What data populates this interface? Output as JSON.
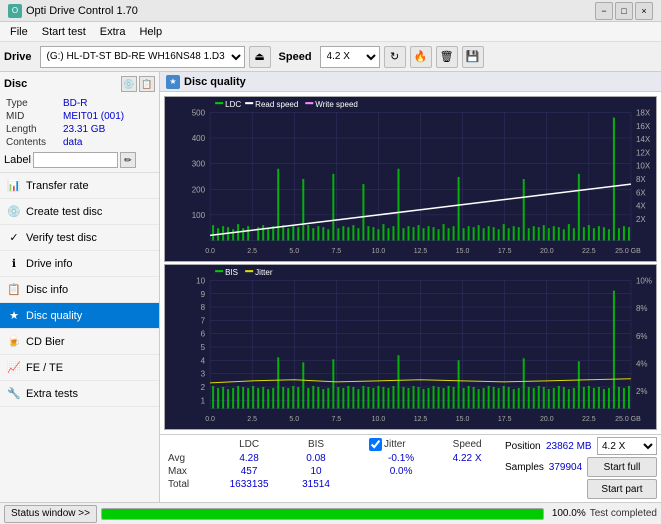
{
  "titlebar": {
    "title": "Opti Drive Control 1.70",
    "min_label": "−",
    "max_label": "□",
    "close_label": "×"
  },
  "menubar": {
    "items": [
      "File",
      "Start test",
      "Extra",
      "Help"
    ]
  },
  "toolbar": {
    "drive_label": "Drive",
    "drive_value": "(G:) HL-DT-ST BD-RE  WH16NS48 1.D3",
    "speed_label": "Speed",
    "speed_value": "4.2 X"
  },
  "sidebar": {
    "disc_section": {
      "title": "Disc",
      "fields": [
        {
          "label": "Type",
          "value": "BD-R"
        },
        {
          "label": "MID",
          "value": "MEIT01 (001)"
        },
        {
          "label": "Length",
          "value": "23.31 GB"
        },
        {
          "label": "Contents",
          "value": "data"
        }
      ],
      "label_placeholder": ""
    },
    "nav_items": [
      {
        "id": "transfer-rate",
        "label": "Transfer rate",
        "icon": "📊"
      },
      {
        "id": "create-test-disc",
        "label": "Create test disc",
        "icon": "💿"
      },
      {
        "id": "verify-test-disc",
        "label": "Verify test disc",
        "icon": "✓"
      },
      {
        "id": "drive-info",
        "label": "Drive info",
        "icon": "ℹ"
      },
      {
        "id": "disc-info",
        "label": "Disc info",
        "icon": "📋"
      },
      {
        "id": "disc-quality",
        "label": "Disc quality",
        "icon": "★",
        "active": true
      },
      {
        "id": "cd-bier",
        "label": "CD Bier",
        "icon": "🍺"
      },
      {
        "id": "fe-te",
        "label": "FE / TE",
        "icon": "📈"
      },
      {
        "id": "extra-tests",
        "label": "Extra tests",
        "icon": "🔧"
      }
    ]
  },
  "quality_panel": {
    "title": "Disc quality",
    "chart1": {
      "legend": [
        "LDC",
        "Read speed",
        "Write speed"
      ],
      "legend_colors": [
        "#00dd00",
        "#ffffff",
        "#ff88ff"
      ],
      "y_labels": [
        "500",
        "400",
        "300",
        "200",
        "100"
      ],
      "y_right_labels": [
        "18X",
        "16X",
        "14X",
        "12X",
        "10X",
        "8X",
        "6X",
        "4X",
        "2X"
      ],
      "x_labels": [
        "0.0",
        "2.5",
        "5.0",
        "7.5",
        "10.0",
        "12.5",
        "15.0",
        "17.5",
        "20.0",
        "22.5",
        "25.0 GB"
      ]
    },
    "chart2": {
      "legend": [
        "BIS",
        "Jitter"
      ],
      "legend_colors": [
        "#00dd00",
        "#ffff00"
      ],
      "y_labels": [
        "10",
        "9",
        "8",
        "7",
        "6",
        "5",
        "4",
        "3",
        "2",
        "1"
      ],
      "y_right_labels": [
        "10%",
        "8%",
        "6%",
        "4%",
        "2%"
      ],
      "x_labels": [
        "0.0",
        "2.5",
        "5.0",
        "7.5",
        "10.0",
        "12.5",
        "15.0",
        "17.5",
        "20.0",
        "22.5",
        "25.0 GB"
      ]
    }
  },
  "stats": {
    "headers": [
      "LDC",
      "BIS",
      "",
      "Jitter",
      "Speed",
      ""
    ],
    "rows": [
      {
        "label": "Avg",
        "ldc": "4.28",
        "bis": "0.08",
        "jitter": "-0.1%",
        "speed_label": "4.22 X"
      },
      {
        "label": "Max",
        "ldc": "457",
        "bis": "10",
        "jitter": "0.0%",
        "position_label": "Position",
        "position_val": "23862 MB"
      },
      {
        "label": "Total",
        "ldc": "1633135",
        "bis": "31514",
        "samples_label": "Samples",
        "samples_val": "379904"
      }
    ],
    "jitter_checked": true,
    "speed_display": "4.2 X",
    "start_full": "Start full",
    "start_part": "Start part"
  },
  "statusbar": {
    "status_btn_label": "Status window >>",
    "progress": 100,
    "status_text": "Test completed"
  }
}
